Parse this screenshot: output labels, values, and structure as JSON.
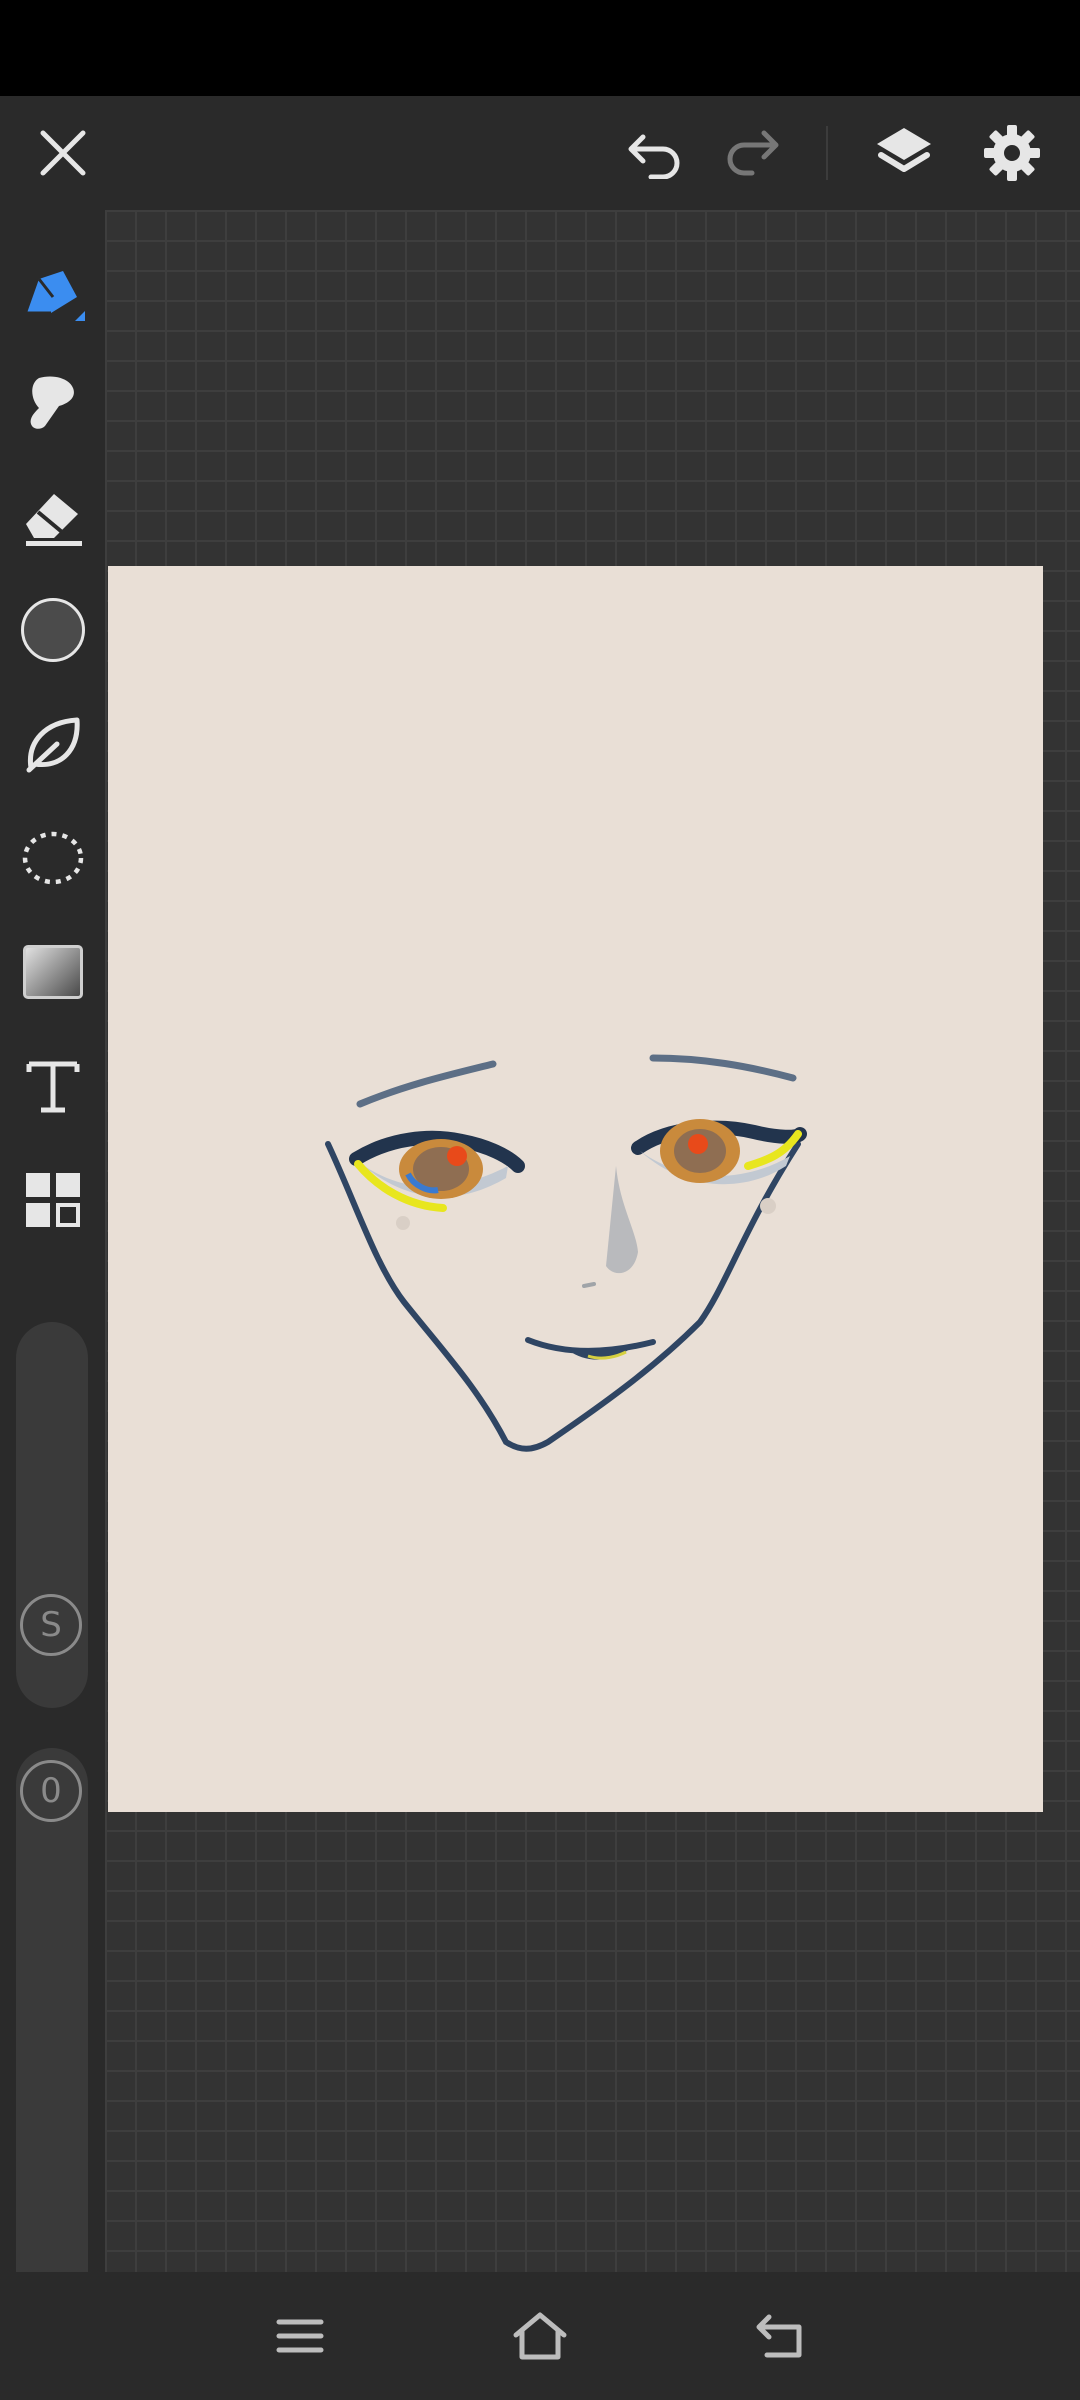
{
  "toolbar": {
    "close": "close-icon",
    "undo": "undo-icon",
    "redo": "redo-icon",
    "layers": "layers-icon",
    "settings": "gear-icon"
  },
  "tools": [
    {
      "name": "pen",
      "icon": "pen-icon",
      "active": true
    },
    {
      "name": "smudge",
      "icon": "smudge-icon"
    },
    {
      "name": "eraser",
      "icon": "eraser-icon"
    },
    {
      "name": "color",
      "icon": "color-swatch",
      "color": "#4b4b4b"
    },
    {
      "name": "leaf",
      "icon": "leaf-icon"
    },
    {
      "name": "lasso",
      "icon": "lasso-icon"
    },
    {
      "name": "gradient",
      "icon": "gradient-icon"
    },
    {
      "name": "text",
      "icon": "text-icon"
    },
    {
      "name": "more",
      "icon": "grid-icon"
    }
  ],
  "sliders": {
    "size_label": "S",
    "opacity_label": "0"
  },
  "colors": {
    "accent": "#3b8df0",
    "canvas": "#e9dfd6",
    "ink": "#2f4563"
  },
  "navbar": {
    "menu": "menu-icon",
    "home": "home-icon",
    "back": "back-icon"
  }
}
